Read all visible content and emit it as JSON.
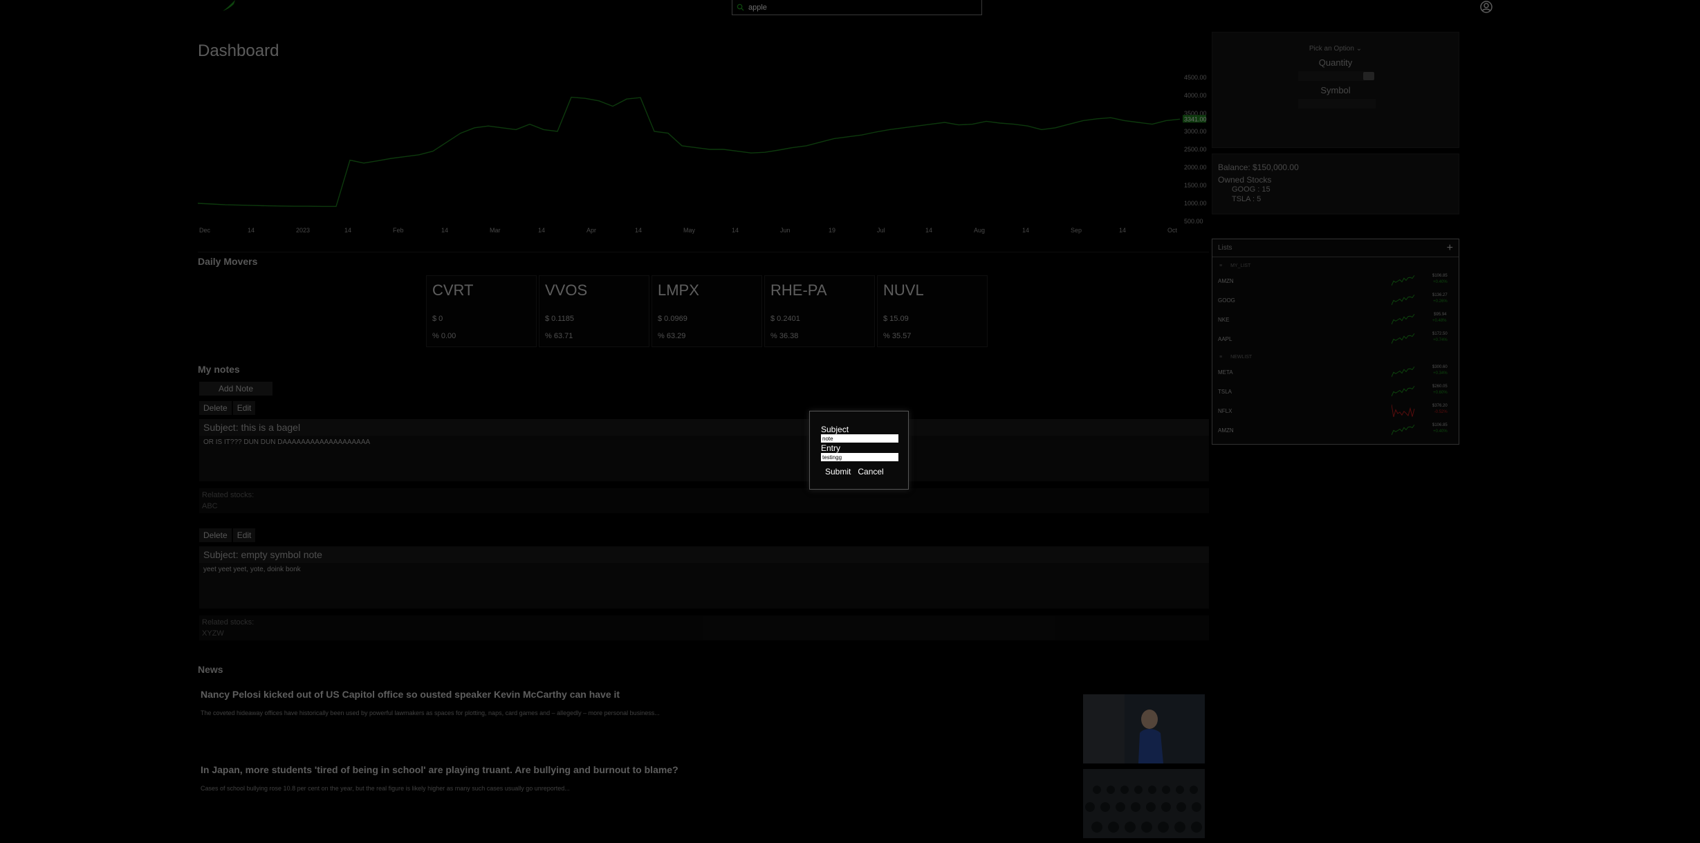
{
  "search": {
    "value": "apple"
  },
  "dashboard": {
    "title": "Dashboard"
  },
  "chart_data": {
    "type": "line",
    "color": "#1f8a1f",
    "x_ticks": [
      "Dec",
      "14",
      "2023",
      "14",
      "Feb",
      "14",
      "Mar",
      "14",
      "Apr",
      "14",
      "May",
      "14",
      "Jun",
      "19",
      "Jul",
      "14",
      "Aug",
      "14",
      "Sep",
      "14",
      "Oct"
    ],
    "y_ticks": [
      "4500.00",
      "4000.00",
      "3500.00",
      "3000.00",
      "2500.00",
      "2000.00",
      "1500.00",
      "1000.00",
      "500.00"
    ],
    "ylim": [
      500,
      4500
    ],
    "last_value_label": "3341.00",
    "values": [
      1000,
      980,
      960,
      950,
      940,
      930,
      925,
      920,
      920,
      915,
      915,
      2200,
      2120,
      2180,
      2250,
      2300,
      2350,
      2450,
      2700,
      2950,
      3100,
      3150,
      3100,
      3050,
      3200,
      3050,
      3000,
      3950,
      3920,
      3850,
      3700,
      3900,
      3940,
      3000,
      2950,
      2600,
      2550,
      2500,
      2500,
      2450,
      2400,
      2420,
      2480,
      2550,
      2600,
      2700,
      2800,
      2850,
      2900,
      2980,
      3050,
      3100,
      3150,
      3200,
      3250,
      3180,
      3200,
      3280,
      3230,
      3200,
      3150,
      3050,
      3100,
      3200,
      3300,
      3350,
      3380,
      3300,
      3250,
      3200,
      3300,
      3341
    ]
  },
  "trade": {
    "pick_label": "Pick an Option",
    "quantity_label": "Quantity",
    "symbol_label": "Symbol"
  },
  "account": {
    "balance": "Balance: $150,000.00",
    "owned_label": "Owned Stocks",
    "holdings": [
      "GOOG : 15",
      "TSLA : 5"
    ]
  },
  "lists": {
    "title": "Lists",
    "add": "+",
    "groups": [
      {
        "name": "MY_LIST",
        "items": [
          {
            "symbol": "AMZN",
            "price": "$106.85",
            "change": "+0.40%",
            "color": "#1fa31f"
          },
          {
            "symbol": "GOOG",
            "price": "$136.27",
            "change": "+0.26%",
            "color": "#1fa31f"
          },
          {
            "symbol": "NKE",
            "price": "$95.94",
            "change": "+0.48%",
            "color": "#1fa31f"
          },
          {
            "symbol": "AAPL",
            "price": "$172.50",
            "change": "+0.74%",
            "color": "#1fa31f"
          }
        ]
      },
      {
        "name": "NEWLIST",
        "items": [
          {
            "symbol": "META",
            "price": "$300.60",
            "change": "+0.34%",
            "color": "#1fa31f"
          },
          {
            "symbol": "TSLA",
            "price": "$260.05",
            "change": "+0.60%",
            "color": "#1fa31f"
          },
          {
            "symbol": "NFLX",
            "price": "$376.20",
            "change": "-0.52%",
            "color": "#d11f1f"
          },
          {
            "symbol": "AMZN",
            "price": "$106.85",
            "change": "+0.40%",
            "color": "#1fa31f"
          }
        ]
      }
    ]
  },
  "movers": {
    "title": "Daily Movers",
    "items": [
      {
        "symbol": "CVRT",
        "price": "$ 0",
        "pct": "% 0.00"
      },
      {
        "symbol": "VVOS",
        "price": "$ 0.1185",
        "pct": "% 63.71"
      },
      {
        "symbol": "LMPX",
        "price": "$ 0.0969",
        "pct": "% 63.29"
      },
      {
        "symbol": "RHE-PA",
        "price": "$ 0.2401",
        "pct": "% 36.38"
      },
      {
        "symbol": "NUVL",
        "price": "$ 15.09",
        "pct": "% 35.57"
      }
    ]
  },
  "notes": {
    "title": "My notes",
    "add_label": "Add Note",
    "delete_label": "Delete",
    "edit_label": "Edit",
    "related_label": "Related stocks:",
    "items": [
      {
        "subject": "Subject: this is a bagel",
        "entry": "OR IS IT??? DUN DUN DAAAAAAAAAAAAAAAAAAA",
        "related": "ABC"
      },
      {
        "subject": "Subject: empty symbol note",
        "entry": "yeet yeet yeet, yote, doink bonk",
        "related": "XYZW"
      }
    ]
  },
  "news": {
    "title": "News",
    "items": [
      {
        "headline": "Nancy Pelosi kicked out of US Capitol office so ousted speaker Kevin McCarthy can have it",
        "blurb": "The coveted hideaway offices have historically been used by powerful lawmakers as spaces for plotting, naps, card games and – allegedly – more personal business..."
      },
      {
        "headline": "In Japan, more students 'tired of being in school' are playing truant. Are bullying and burnout to blame?",
        "blurb": "Cases of school bullying rose 10.8 per cent on the year, but the real figure is likely higher as many such cases usually go unreported..."
      }
    ]
  },
  "modal": {
    "subject_label": "Subject",
    "subject_value": "note",
    "entry_label": "Entry",
    "entry_value": "testingg",
    "submit_label": "Submit",
    "cancel_label": "Cancel"
  }
}
